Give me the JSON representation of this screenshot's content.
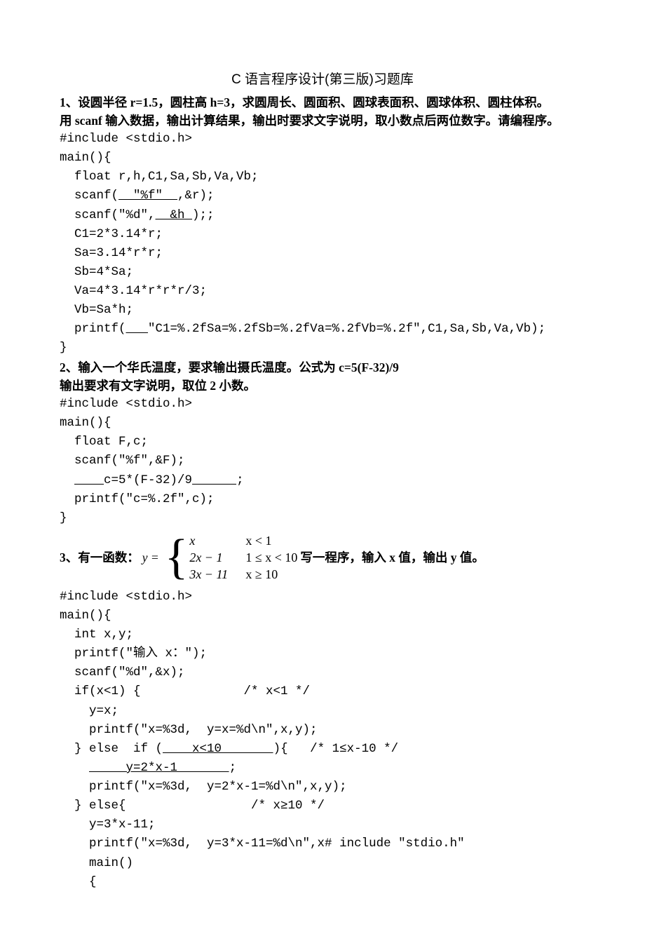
{
  "title": "C 语言程序设计(第三版)习题库",
  "p1": {
    "l1": "1、设圆半径 r=1.5，圆柱高 h=3，求圆周长、圆面积、圆球表面积、圆球体积、圆柱体积。",
    "l2": "用 scanf 输入数据，输出计算结果，输出时要求文字说明，取小数点后两位数字。请编程序。",
    "c1": "#include <stdio.h>",
    "c2": "main(){",
    "c3": "  float r,h,C1,Sa,Sb,Va,Vb;",
    "c4a": "  scanf(",
    "c4b": "  \"%f\"  ",
    "c4c": ",&r);",
    "c5a": "  scanf(\"%d\",",
    "c5b": "  &h ",
    "c5c": ");;",
    "c6": "  C1=2*3.14*r;",
    "c7": "  Sa=3.14*r*r;",
    "c8": "  Sb=4*Sa;",
    "c9": "  Va=4*3.14*r*r*r/3;",
    "c10": "  Vb=Sa*h;",
    "c11a": "  printf(",
    "c11b": "   ",
    "c11c": "\"C1=%.2fSa=%.2fSb=%.2fVa=%.2fVb=%.2f\",C1,Sa,Sb,Va,Vb);",
    "c12": "}"
  },
  "p2": {
    "l1": "2、输入一个华氏温度，要求输出摄氏温度。公式为  c=5(F-32)/9",
    "l2": "输出要求有文字说明，取位 2 小数。",
    "c1": "#include <stdio.h>",
    "c2": "main(){",
    "c3": "  float F,c;",
    "c4": "  scanf(\"%f\",&F);",
    "c5a": "  ",
    "c5b": "    ",
    "c5c": "c=5*(F-32)/9",
    "c5d": "      ",
    "c5e": ";",
    "c6": "  printf(\"c=%.2f\",c);",
    "c7": "}"
  },
  "p3": {
    "lead": "3、有一函数：",
    "yeq": "y =",
    "r1a": "x",
    "r1b": "x < 1",
    "r2a": "2x − 1",
    "r2b": "1 ≤ x < 10",
    "r3a": "3x − 11",
    "r3b": "x ≥ 10",
    "tail": " 写一程序，输入 x 值，输出 y 值。",
    "c1": "#include <stdio.h>",
    "c2": "main(){",
    "c3": "  int x,y;",
    "c4": "  printf(\"输入 x：\");",
    "c5": "  scanf(\"%d\",&x);",
    "c6": "  if(x<1) {              /* x<1 */",
    "c7": "    y=x;",
    "c8": "    printf(\"x=%3d,  y=x=%d\\n\",x,y);",
    "c9a": "  } else  if (",
    "c9b": "    x<10       ",
    "c9c": "){   /* 1≤x-10 */",
    "c10a": "    ",
    "c10b": "     y=2*x-1       ",
    "c10c": ";",
    "c11": "    printf(\"x=%3d,  y=2*x-1=%d\\n\",x,y);",
    "c12": "  } else{                 /* x≥10 */",
    "c13": "    y=3*x-11;",
    "c14": "    printf(\"x=%3d,  y=3*x-11=%d\\n\",x# include \"stdio.h\"",
    "c15": "    main()",
    "c16": "    {"
  }
}
